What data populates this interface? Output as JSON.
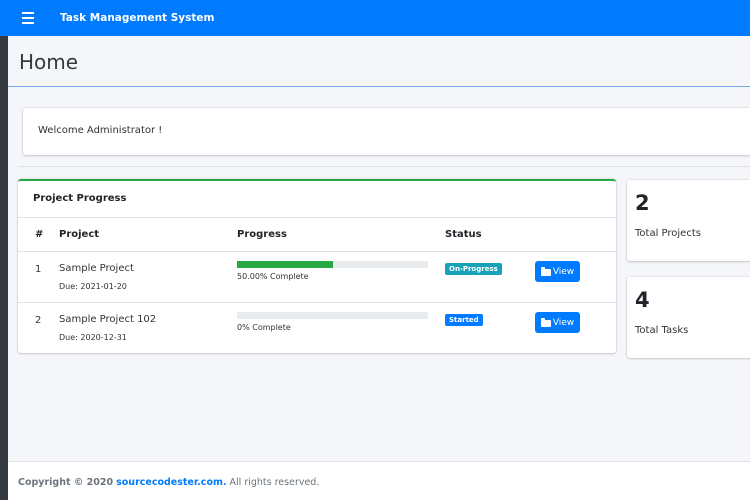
{
  "navbar": {
    "title": "Task Management System",
    "menu_icon": "hamburger-menu-icon"
  },
  "header": {
    "title": "Home"
  },
  "welcome": {
    "message": "Welcome Administrator !"
  },
  "project_progress": {
    "title": "Project Progress",
    "columns": [
      "#",
      "Project",
      "Progress",
      "Status"
    ],
    "rows": [
      {
        "index": "1",
        "project": "Sample Project",
        "due": "Due: 2021-01-20",
        "progress_label": "50.00% Complete",
        "progress_value": 50,
        "status": "On-Progress",
        "action": "View"
      },
      {
        "index": "2",
        "project": "Sample Project 102",
        "due": "Due: 2020-12-31",
        "progress_label": "0% Complete",
        "progress_value": 0,
        "status": "Started",
        "action": "View"
      }
    ]
  },
  "stats": [
    {
      "value": "2",
      "label": "Total Projects"
    },
    {
      "value": "4",
      "label": "Total Tasks"
    }
  ],
  "footer": {
    "prefix": "Copyright © 2020",
    "link": "sourcecodester.com.",
    "suffix": "All rights reserved."
  },
  "colors": {
    "primary": "#007bff",
    "success": "#28a745",
    "info": "#17a2b8",
    "sidebar": "#343a40"
  }
}
